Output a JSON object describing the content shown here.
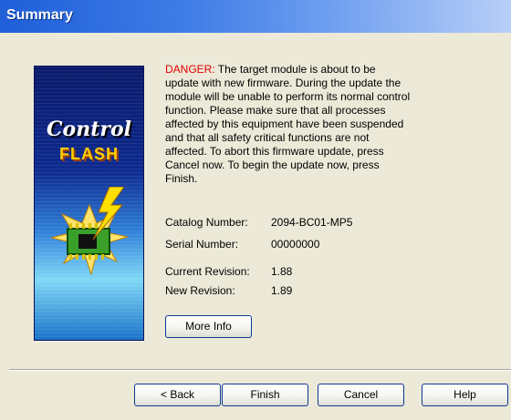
{
  "window": {
    "title": "Summary"
  },
  "logo": {
    "word1": "Control",
    "word2": "FLASH"
  },
  "message": {
    "danger_label": "DANGER:",
    "lines": [
      " The target module is about to be",
      "update with new firmware. During the update the",
      "module will be unable to perform its normal control",
      "function. Please make sure that all processes",
      "affected by this equipment have been suspended",
      "and that all safety critical functions are not",
      "affected. To abort this firmware update, press",
      "Cancel now. To begin the update now, press",
      "Finish."
    ]
  },
  "fields": {
    "catalog_label": "Catalog Number:",
    "catalog_value": "2094-BC01-MP5",
    "serial_label": "Serial Number:",
    "serial_value": "00000000",
    "current_label": "Current Revision:",
    "current_value": "1.88",
    "new_label": "New Revision:",
    "new_value": "1.89"
  },
  "buttons": {
    "more_info": "More Info",
    "back": "< Back",
    "finish": "Finish",
    "cancel": "Cancel",
    "help": "Help"
  }
}
